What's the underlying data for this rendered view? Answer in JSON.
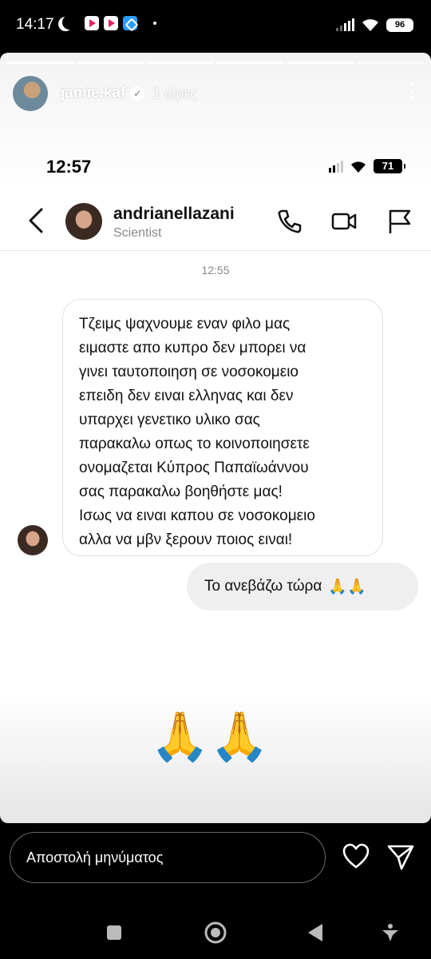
{
  "status_bar": {
    "time": "14:17",
    "battery": "96"
  },
  "story": {
    "username": "jamie.kaf",
    "age": "1 ώρες",
    "segments": 6
  },
  "screenshot": {
    "ios_time": "12:57",
    "ios_battery": "71",
    "contact_name": "andrianellazani",
    "contact_subtitle": "Scientist",
    "timestamp": "12:55",
    "incoming_lines": [
      "Τζειμς ψαχνουμε εναν φιλο μας",
      "ειμαστε απο κυπρο δεν μπορει να",
      "γινει ταυτοποιηση σε νοσοκομειο",
      "επειδη δεν ειναι ελληνας και δεν",
      "υπαρχει γενετικο υλικο σας",
      "παρακαλω οπως το κοινοποιησετε",
      "ονομαζεται Κύπρος Παπαϊωάννου",
      "σας παρακαλω βοηθήστε μας!",
      "Ισως να ειναι καπου σε νοσοκομειο",
      "αλλα να μβν ξερουν ποιος ειναι!"
    ],
    "outgoing_text": "Το ανεβάζω τώρα",
    "outgoing_emoji": "🙏🙏",
    "big_emoji": "🙏🙏"
  },
  "reply": {
    "placeholder": "Αποστολή μηνύματος"
  },
  "icons": {
    "header": [
      "phone-icon",
      "video-call-icon",
      "flag-icon"
    ],
    "reply": [
      "heart-icon",
      "send-icon"
    ],
    "nav": [
      "recents-icon",
      "home-icon",
      "back-nav-icon",
      "accessibility-icon"
    ]
  }
}
